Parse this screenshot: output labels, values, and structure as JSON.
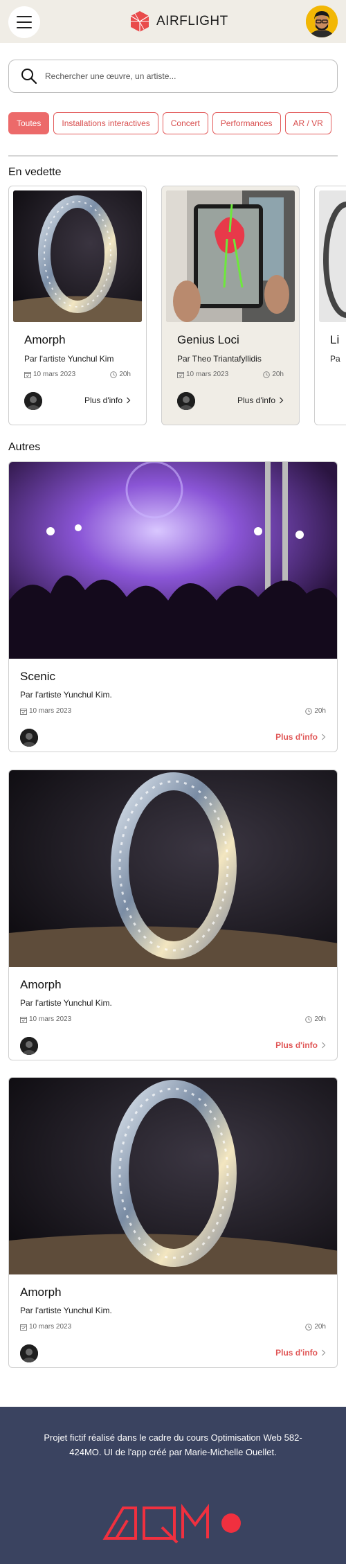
{
  "header": {
    "app_name": "AIRFLIGHT",
    "menu_icon": "hamburger-icon",
    "brand_color": "#e94b4b"
  },
  "search": {
    "placeholder": "Rechercher une œuvre, un artiste...",
    "value": ""
  },
  "filters": [
    {
      "label": "Toutes",
      "active": true
    },
    {
      "label": "Installations interactives",
      "active": false
    },
    {
      "label": "Concert",
      "active": false
    },
    {
      "label": "Performances",
      "active": false
    },
    {
      "label": "AR / VR",
      "active": false
    }
  ],
  "featured": {
    "title": "En vedette",
    "items": [
      {
        "title": "Amorph",
        "artist": "Par l'artiste Yunchul Kim",
        "date": "10 mars 2023",
        "time": "20h",
        "more": "Plus d'info"
      },
      {
        "title": "Genius Loci",
        "artist": "Par Theo Triantafyllidis",
        "date": "10 mars 2023",
        "time": "20h",
        "more": "Plus d'info"
      },
      {
        "title": "Li",
        "artist": "Pa"
      }
    ]
  },
  "others": {
    "title": "Autres",
    "items": [
      {
        "title": "Scenic",
        "artist": "Par l'artiste Yunchul Kim.",
        "date": "10 mars 2023",
        "time": "20h",
        "more": "Plus d'info"
      },
      {
        "title": "Amorph",
        "artist": "Par l'artiste Yunchul Kim.",
        "date": "10 mars 2023",
        "time": "20h",
        "more": "Plus d'info"
      },
      {
        "title": "Amorph",
        "artist": "Par l'artiste Yunchul Kim.",
        "date": "10 mars 2023",
        "time": "20h",
        "more": "Plus d'info"
      }
    ]
  },
  "footer": {
    "text": "Projet fictif réalisé dans le cadre du cours Optimisation Web 582-424MO. UI de l'app créé par Marie-Michelle Ouellet.",
    "logo_text": "AQM",
    "background": "#3a4360"
  }
}
